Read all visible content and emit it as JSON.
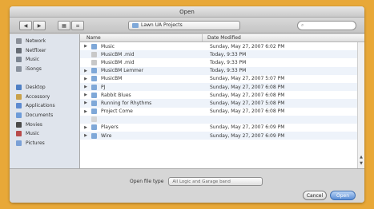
{
  "window": {
    "title": "Open"
  },
  "toolbar": {
    "back_icon": "back-arrow-icon",
    "forward_icon": "forward-arrow-icon",
    "path": "Lawn UA Projects",
    "search_placeholder": ""
  },
  "sidebar": {
    "items": [
      {
        "label": "Network",
        "icon": "network-icon",
        "color": "#8a8f98"
      },
      {
        "label": "Netflixer",
        "icon": "disk-icon",
        "color": "#666c74"
      },
      {
        "label": "Music",
        "icon": "disk-icon",
        "color": "#7c8591"
      },
      {
        "label": "iSongs",
        "icon": "disk-icon",
        "color": "#8a929e"
      },
      {
        "label": "",
        "icon": "",
        "color": ""
      },
      {
        "label": "Desktop",
        "icon": "desktop-icon",
        "color": "#4f7fc4"
      },
      {
        "label": "Accessory",
        "icon": "home-icon",
        "color": "#c9a14a"
      },
      {
        "label": "Applications",
        "icon": "applications-icon",
        "color": "#5d8ad0"
      },
      {
        "label": "Documents",
        "icon": "documents-icon",
        "color": "#6d9bd8"
      },
      {
        "label": "Movies",
        "icon": "movies-icon",
        "color": "#4a4a4a"
      },
      {
        "label": "Music",
        "icon": "music-icon",
        "color": "#b84b4b"
      },
      {
        "label": "Pictures",
        "icon": "pictures-icon",
        "color": "#7aa0d6"
      }
    ]
  },
  "columns": {
    "name": "Name",
    "date": "Date Modified"
  },
  "files": [
    {
      "name": "Music",
      "date": "Sunday, May 27, 2007 6:02 PM",
      "expandable": true,
      "icon": "folder-icon",
      "disabled": false
    },
    {
      "name": "MusicBM .mid",
      "date": "Today, 9:33 PM",
      "expandable": false,
      "icon": "document-icon",
      "disabled": false
    },
    {
      "name": "MusicBM .mid",
      "date": "Today, 9:33 PM",
      "expandable": false,
      "icon": "document-icon",
      "disabled": false
    },
    {
      "name": "MusicBM Lemmer",
      "date": "Today, 9:33 PM",
      "expandable": true,
      "icon": "folder-icon",
      "disabled": false
    },
    {
      "name": "MusicBM",
      "date": "Sunday, May 27, 2007 5:07 PM",
      "expandable": true,
      "icon": "folder-icon",
      "disabled": false
    },
    {
      "name": "PJ",
      "date": "Sunday, May 27, 2007 6:08 PM",
      "expandable": true,
      "icon": "folder-icon",
      "disabled": false
    },
    {
      "name": "Rabbit Blues",
      "date": "Sunday, May 27, 2007 6:08 PM",
      "expandable": true,
      "icon": "folder-icon",
      "disabled": false
    },
    {
      "name": "Running for Rhythms",
      "date": "Sunday, May 27, 2007 5:08 PM",
      "expandable": true,
      "icon": "folder-icon",
      "disabled": false
    },
    {
      "name": "Project Come",
      "date": "Sunday, May 27, 2007 6:08 PM",
      "expandable": true,
      "icon": "folder-icon",
      "disabled": false
    },
    {
      "name": "",
      "date": "",
      "expandable": false,
      "icon": "document-icon",
      "disabled": true
    },
    {
      "name": "Players",
      "date": "Sunday, May 27, 2007 6:09 PM",
      "expandable": true,
      "icon": "folder-icon",
      "disabled": false
    },
    {
      "name": "Wire",
      "date": "Sunday, May 27, 2007 6:09 PM",
      "expandable": true,
      "icon": "folder-icon",
      "disabled": false
    }
  ],
  "footer": {
    "enable_label": "Open file type",
    "enable_value": "All Logic and Garage band",
    "cancel_label": "Cancel",
    "open_label": "Open"
  },
  "colors": {
    "desktop": "#e8a838",
    "folder": "#7fa8d8",
    "selection": "#eef3fa",
    "default_button": "#5b8ed6"
  }
}
